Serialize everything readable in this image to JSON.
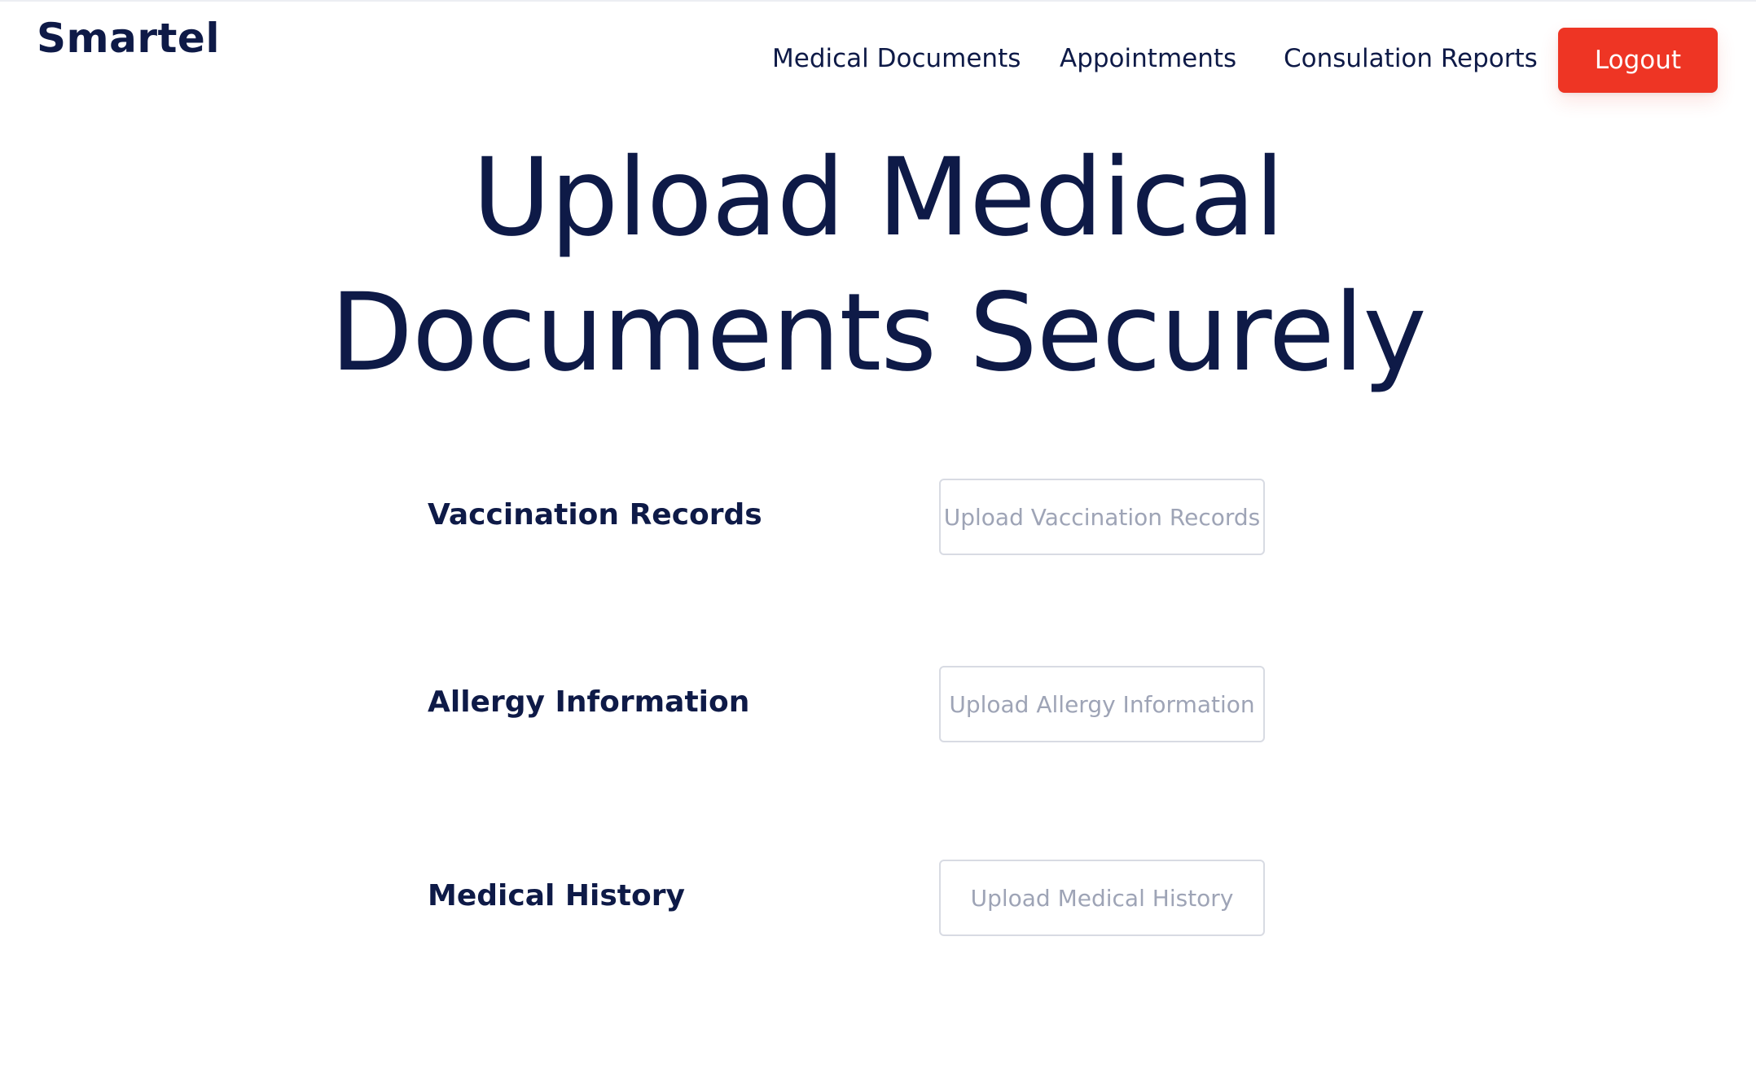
{
  "header": {
    "brand": "Smartel",
    "nav": {
      "medical_documents": "Medical Documents",
      "appointments": "Appointments",
      "consultation_reports": "Consulation Reports"
    },
    "logout_label": "Logout"
  },
  "hero": {
    "line1": "Upload Medical",
    "line2": "Documents Securely"
  },
  "uploads": [
    {
      "label": "Vaccination Records",
      "button": "Upload Vaccination Records"
    },
    {
      "label": "Allergy Information",
      "button": "Upload Allergy Information"
    },
    {
      "label": "Medical History",
      "button": "Upload Medical History"
    }
  ],
  "colors": {
    "primary_text": "#0e1a47",
    "accent": "#ee3524",
    "placeholder": "#9ea4b6",
    "border": "#d8dbe3"
  }
}
